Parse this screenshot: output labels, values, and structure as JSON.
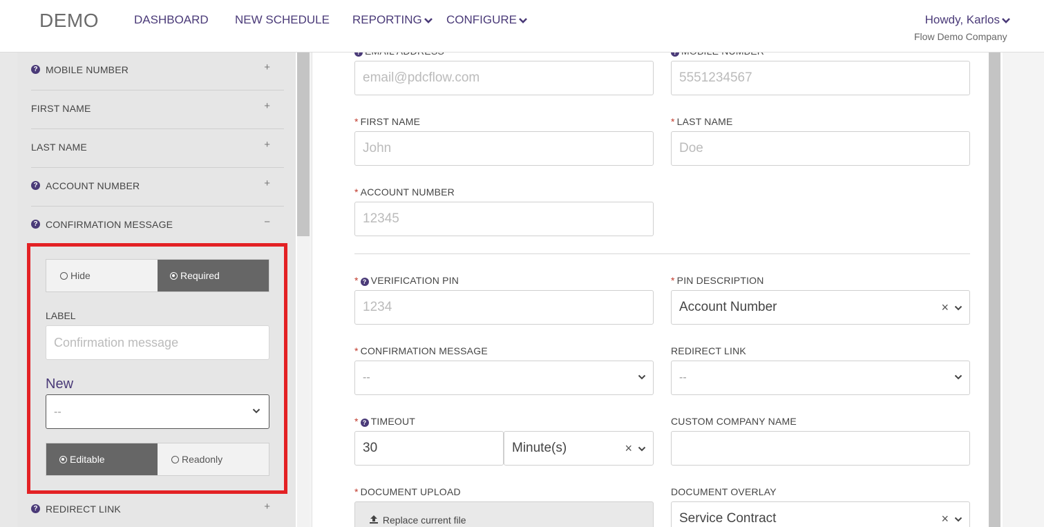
{
  "header": {
    "logo": "DEMO",
    "nav": {
      "dashboard": "DASHBOARD",
      "new_schedule": "NEW SCHEDULE",
      "reporting": "REPORTING",
      "configure": "CONFIGURE"
    },
    "user": "Howdy, Karlos",
    "company": "Flow Demo Company"
  },
  "sidebar": {
    "items": [
      {
        "label": "MOBILE NUMBER",
        "help": true,
        "toggle": "+"
      },
      {
        "label": "FIRST NAME",
        "help": false,
        "toggle": "+"
      },
      {
        "label": "LAST NAME",
        "help": false,
        "toggle": "+"
      },
      {
        "label": "ACCOUNT NUMBER",
        "help": true,
        "toggle": "+"
      },
      {
        "label": "CONFIRMATION MESSAGE",
        "help": true,
        "toggle": "−"
      },
      {
        "label": "REDIRECT LINK",
        "help": true,
        "toggle": "+"
      }
    ],
    "expanded": {
      "visibility": {
        "hide": "Hide",
        "required": "Required",
        "selected": "Required"
      },
      "label_title": "LABEL",
      "label_placeholder": "Confirmation message",
      "new_title": "New",
      "select_value": "--",
      "mode": {
        "editable": "Editable",
        "readonly": "Readonly",
        "selected": "Editable"
      }
    }
  },
  "form": {
    "email": {
      "label": "EMAIL ADDRESS",
      "placeholder": "email@pdcflow.com"
    },
    "mobile": {
      "label": "MOBILE NUMBER",
      "placeholder": "5551234567"
    },
    "first_name": {
      "label": "FIRST NAME",
      "placeholder": "John"
    },
    "last_name": {
      "label": "LAST NAME",
      "placeholder": "Doe"
    },
    "account_number": {
      "label": "ACCOUNT NUMBER",
      "placeholder": "12345"
    },
    "verification_pin": {
      "label": "VERIFICATION PIN",
      "placeholder": "1234"
    },
    "pin_description": {
      "label": "PIN DESCRIPTION",
      "value": "Account Number"
    },
    "confirmation_message": {
      "label": "CONFIRMATION MESSAGE",
      "value": "--"
    },
    "redirect_link": {
      "label": "REDIRECT LINK",
      "value": "--"
    },
    "timeout": {
      "label": "TIMEOUT",
      "value": "30",
      "unit": "Minute(s)"
    },
    "custom_company_name": {
      "label": "CUSTOM COMPANY NAME",
      "value": ""
    },
    "document_upload": {
      "label": "DOCUMENT UPLOAD",
      "button": "Replace current file"
    },
    "document_overlay": {
      "label": "DOCUMENT OVERLAY",
      "value": "Service Contract"
    }
  },
  "colors": {
    "brand": "#4a3a78",
    "highlight": "#e32124",
    "required": "#c0392b",
    "active_segment": "#666666"
  }
}
